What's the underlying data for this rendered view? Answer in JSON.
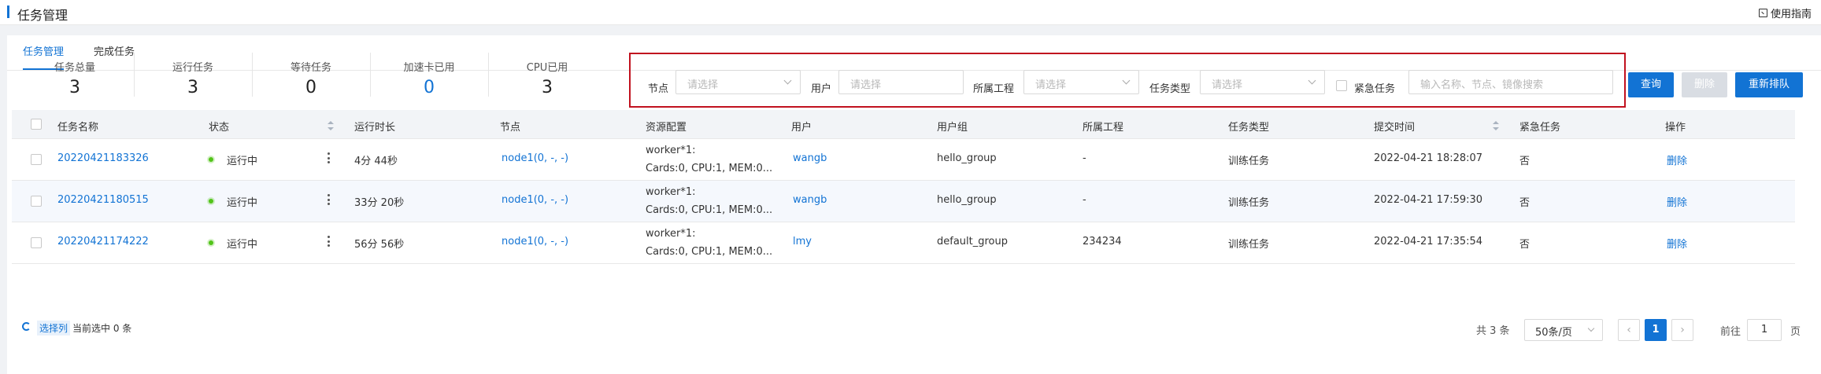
{
  "header": {
    "title": "任务管理",
    "guide_label": "使用指南"
  },
  "tabs": [
    {
      "label": "任务管理",
      "active": true
    },
    {
      "label": "完成任务",
      "active": false
    }
  ],
  "stats": [
    {
      "label": "任务总量",
      "value": "3"
    },
    {
      "label": "运行任务",
      "value": "3"
    },
    {
      "label": "等待任务",
      "value": "0"
    },
    {
      "label": "加速卡已用",
      "value": "0"
    },
    {
      "label": "CPU已用",
      "value": "3"
    }
  ],
  "filters": {
    "node_label": "节点",
    "node_placeholder": "请选择",
    "user_label": "用户",
    "user_placeholder": "请选择",
    "project_label": "所属工程",
    "project_placeholder": "请选择",
    "type_label": "任务类型",
    "type_placeholder": "请选择",
    "urgent_label": "紧急任务",
    "search_placeholder": "输入名称、节点、镜像搜索"
  },
  "buttons": {
    "query": "查询",
    "delete": "删除",
    "requeue": "重新排队"
  },
  "table": {
    "columns": [
      "任务名称",
      "状态",
      "运行时长",
      "节点",
      "资源配置",
      "用户",
      "用户组",
      "所属工程",
      "任务类型",
      "提交时间",
      "紧急任务",
      "操作"
    ],
    "rows": [
      {
        "name": "20220421183326",
        "status": "运行中",
        "duration": "4分 44秒",
        "node": "node1(0, -, -)",
        "res1": "worker*1:",
        "res2": "Cards:0, CPU:1, MEM:0...",
        "user": "wangb",
        "group": "hello_group",
        "project": "-",
        "type": "训练任务",
        "submitted": "2022-04-21 18:28:07",
        "urgent": "否",
        "action": "删除"
      },
      {
        "name": "20220421180515",
        "status": "运行中",
        "duration": "33分 20秒",
        "node": "node1(0, -, -)",
        "res1": "worker*1:",
        "res2": "Cards:0, CPU:1, MEM:0...",
        "user": "wangb",
        "group": "hello_group",
        "project": "-",
        "type": "训练任务",
        "submitted": "2022-04-21 17:59:30",
        "urgent": "否",
        "action": "删除"
      },
      {
        "name": "20220421174222",
        "status": "运行中",
        "duration": "56分 56秒",
        "node": "node1(0, -, -)",
        "res1": "worker*1:",
        "res2": "Cards:0, CPU:1, MEM:0...",
        "user": "lmy",
        "group": "default_group",
        "project": "234234",
        "type": "训练任务",
        "submitted": "2022-04-21 17:35:54",
        "urgent": "否",
        "action": "删除"
      }
    ]
  },
  "footer": {
    "select_cols": "选择列",
    "selected_text": "当前选中 0 条",
    "total": "共 3 条",
    "page_size": "50条/页",
    "prev": "‹",
    "current_page": "1",
    "next": "›",
    "goto_label": "前往",
    "goto_value": "1",
    "page_suffix": "页"
  },
  "colors": {
    "accent": "#1273d4",
    "highlight_border": "#c1121f",
    "running_dot": "#52c41a"
  }
}
